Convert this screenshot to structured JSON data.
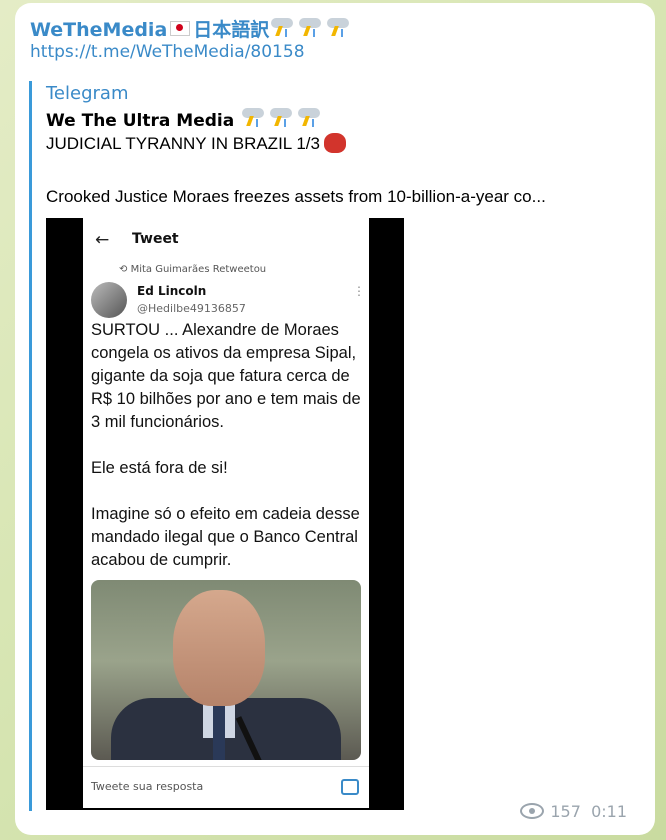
{
  "message": {
    "channel": "WeTheMedia",
    "channel_suffix": "日本語訳",
    "link": "https://t.me/WeTheMedia/80158",
    "forward": {
      "source": "Telegram",
      "name": "We The Ultra Media",
      "headline": "JUDICIAL TYRANNY IN BRAZIL 1/3",
      "text": "Crooked Justice Moraes freezes assets from 10-billion-a-year co..."
    },
    "views": "157",
    "time": "0:11"
  },
  "tweet": {
    "header": "Tweet",
    "retweeted_by": "Mita Guimarães Retweetou",
    "author": "Ed Lincoln",
    "handle": "@Hedilbe49136857",
    "para1": "SURTOU ... Alexandre de Moraes congela os ativos da empresa Sipal, gigante da soja que fatura cerca de R$ 10 bilhões por ano e tem mais de 3 mil funcionários.",
    "para2": "Ele está fora de si!",
    "para3": "Imagine só o efeito em cadeia desse mandado ilegal que o Banco Central acabou de cumprir.",
    "reply_placeholder": "Tweete sua resposta"
  }
}
